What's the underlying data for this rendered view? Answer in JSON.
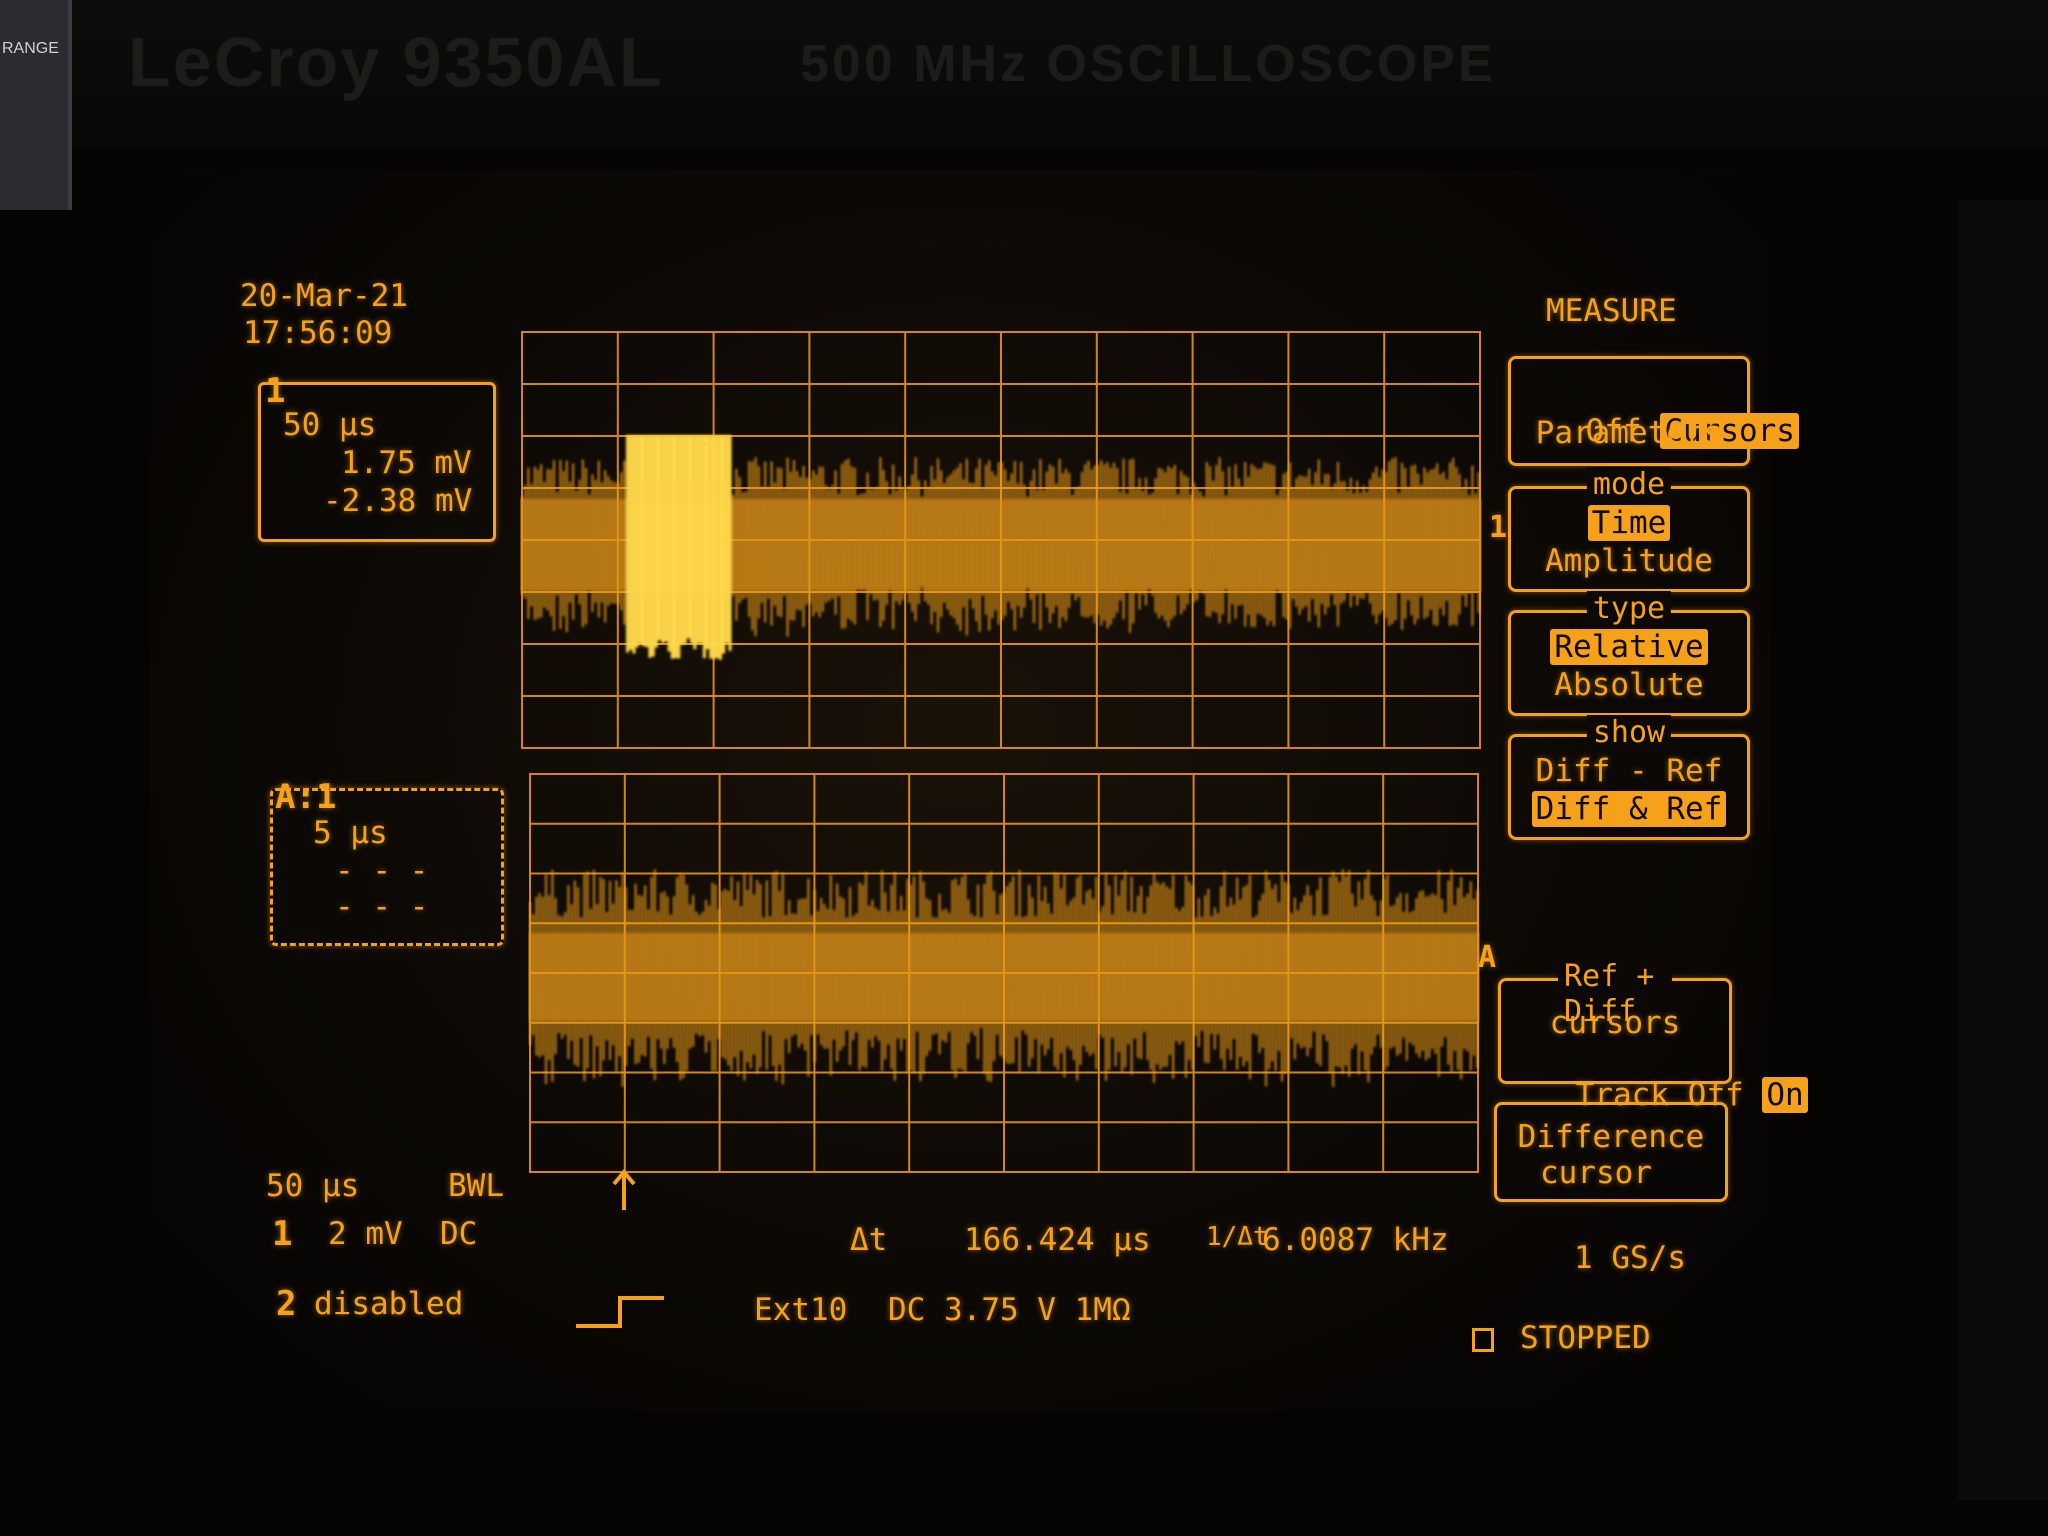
{
  "bezel": {
    "model": "LeCroy 9350AL",
    "description": "500 MHz OSCILLOSCOPE",
    "corner_tag": "RANGE"
  },
  "timestamp": {
    "date": "20-Mar-21",
    "time": "17:56:09"
  },
  "trace1_box": {
    "channel": "1",
    "timebase": "50 µs",
    "value1": "1.75 mV",
    "value2": "-2.38 mV"
  },
  "traceA_box": {
    "label": "A:1",
    "timebase": "5 µs",
    "value1": "- - -",
    "value2": "- - -"
  },
  "markers": {
    "trace1": "1",
    "traceA": "A"
  },
  "measure_menu": {
    "title": "MEASURE",
    "btn1": {
      "option_off": "Off",
      "option_cursors": "Cursors",
      "option_params": "Parameters",
      "selected": "Cursors"
    },
    "btn2": {
      "legend": "mode",
      "opt_a": "Time",
      "opt_b": "Amplitude",
      "selected": "Time"
    },
    "btn3": {
      "legend": "type",
      "opt_a": "Relative",
      "opt_b": "Absolute",
      "selected": "Relative"
    },
    "btn4": {
      "legend": "show",
      "opt_a": "Diff - Ref",
      "opt_b": "Diff & Ref",
      "selected": "Diff & Ref"
    },
    "btn5": {
      "legend": "Ref + Diff",
      "line1": "cursors",
      "track_label": "Track",
      "opt_off": "Off",
      "opt_on": "On",
      "selected": "On"
    },
    "btn6": {
      "line1": "Difference",
      "line2": "cursor"
    }
  },
  "status": {
    "timebase": "50 µs",
    "bwl": "BWL",
    "ch1_num": "1",
    "ch1_setting": "2 mV  DC",
    "ch2_num": "2",
    "ch2_setting": "disabled",
    "delta_t_label": "Δt",
    "delta_t_value": "166.424 µs",
    "inv_label": "1/Δt",
    "inv_value": "6.0087 kHz",
    "sample_rate": "1 GS/s",
    "trigger_source": "Ext10",
    "trigger_setting": "DC 3.75 V 1MΩ",
    "state": "STOPPED"
  },
  "colors": {
    "phosphor": "#f5a21a",
    "background": "#050403",
    "highlight_text": "#120b03"
  }
}
